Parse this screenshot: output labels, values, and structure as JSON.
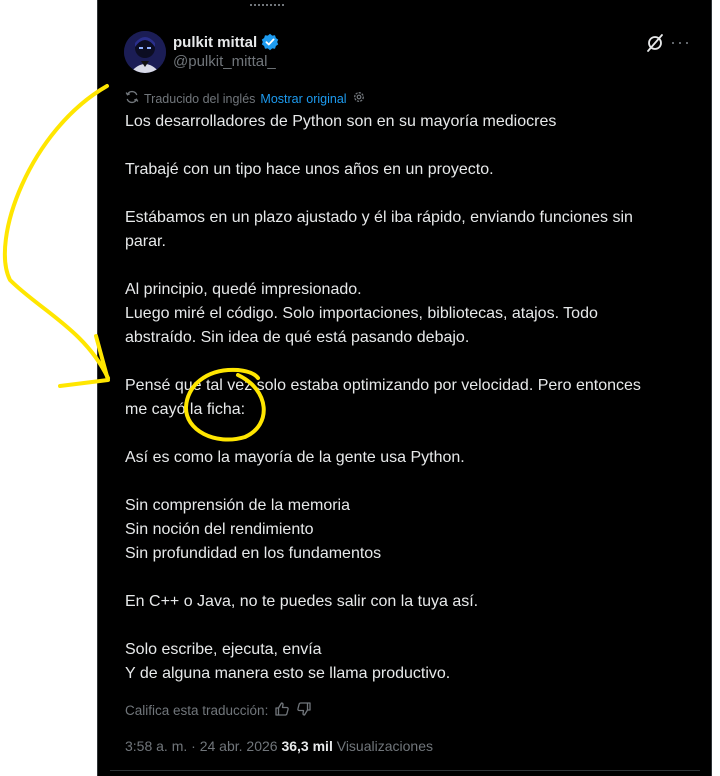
{
  "author": {
    "display_name": "pulkit mittal",
    "handle": "@pulkit_mittal_",
    "verified": true
  },
  "translation": {
    "label": "Traducido del inglés",
    "show_original": "Mostrar original",
    "rate_label": "Califica esta traducción:"
  },
  "body": [
    [
      "Los desarrolladores de Python son en su mayoría mediocres"
    ],
    [
      "Trabajé con un tipo hace unos años en un proyecto."
    ],
    [
      "Estábamos en un plazo ajustado y él iba rápido, enviando funciones sin",
      "parar."
    ],
    [
      "Al principio, quedé impresionado.",
      "Luego miré el código. Solo importaciones, bibliotecas, atajos. Todo",
      "abstraído. Sin idea de qué está pasando debajo."
    ],
    [
      "Pensé que tal vez solo estaba optimizando por velocidad. Pero entonces",
      "me cayó la ficha:"
    ],
    [
      "Así es como la mayoría de la gente usa Python."
    ],
    [
      "Sin comprensión de la memoria",
      "Sin noción del rendimiento",
      "Sin profundidad en los fundamentos"
    ],
    [
      "En C++ o Java, no te puedes salir con la tuya así."
    ],
    [
      "Solo escribe, ejecuta, envía",
      "Y de alguna manera esto se llama productivo."
    ]
  ],
  "meta": {
    "time": "3:58 a. m.",
    "separator": " · ",
    "date": "24 abr. 2026",
    "views_count": "36,3 mil",
    "views_label": "Visualizaciones"
  },
  "colors": {
    "background": "#000000",
    "text": "#e7e9ea",
    "muted": "#71767b",
    "link": "#1d9bf0",
    "annotation": "#ffe600"
  },
  "icons": [
    "verified-badge-icon",
    "grok-icon",
    "more-icon",
    "translate-icon",
    "settings-icon",
    "thumbs-up-icon",
    "thumbs-down-icon"
  ]
}
